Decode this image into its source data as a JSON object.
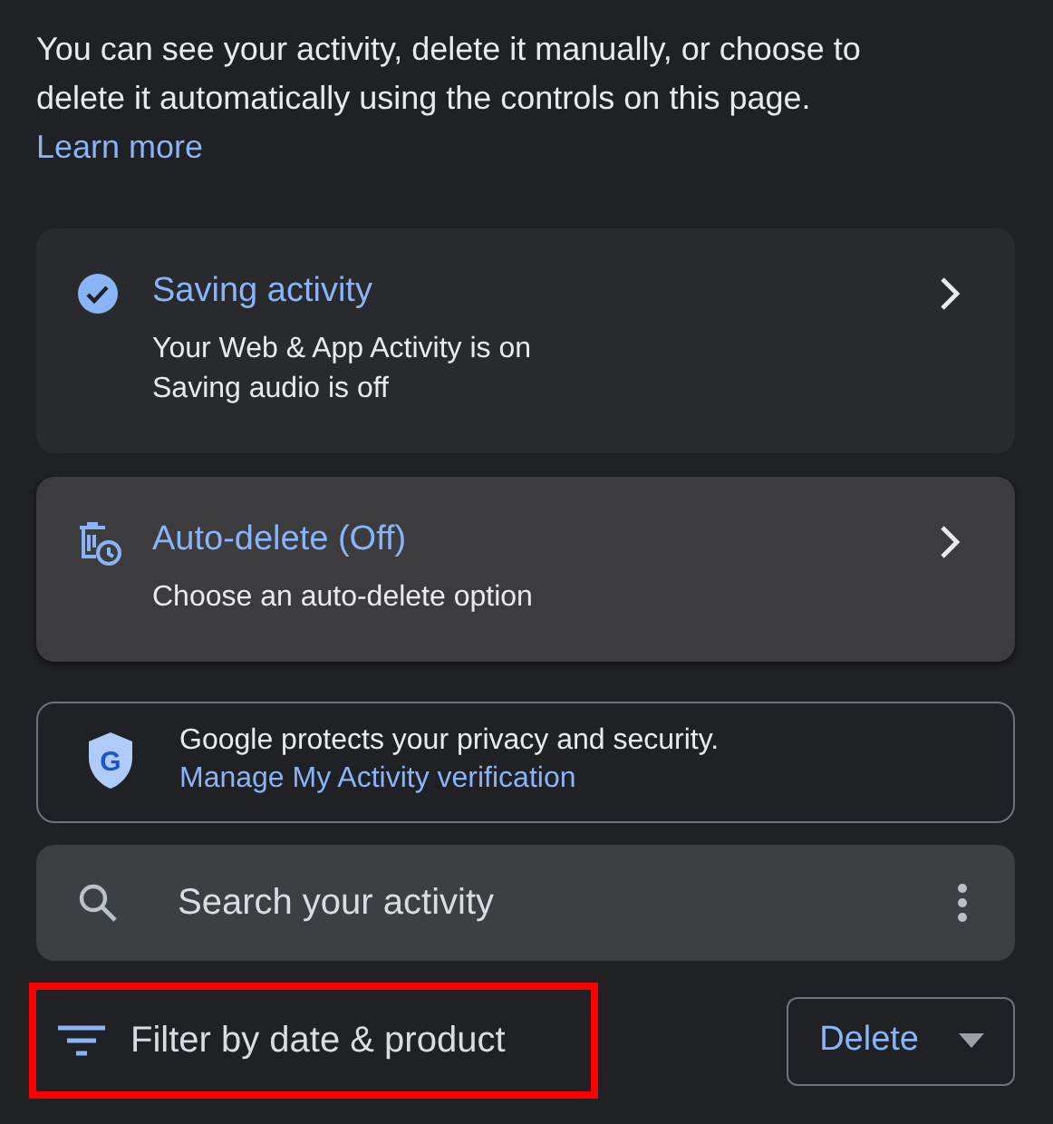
{
  "intro": {
    "text": "You can see your activity, delete it manually, or choose to delete it automatically using the controls on this page.",
    "link": "Learn more"
  },
  "cards": [
    {
      "kind": "saving",
      "title": "Saving activity",
      "lines": [
        "Your Web & App Activity is on",
        "Saving audio is off"
      ],
      "hovered": false
    },
    {
      "kind": "autodelete",
      "title": "Auto-delete (Off)",
      "lines": [
        "Choose an auto-delete option"
      ],
      "hovered": true
    }
  ],
  "privacy": {
    "badge": "G",
    "text": "Google protects your privacy and security.",
    "link": "Manage My Activity verification"
  },
  "search": {
    "placeholder": "Search your activity"
  },
  "filter": {
    "label": "Filter by date & product",
    "highlighted": true
  },
  "delete_button": {
    "label": "Delete"
  }
}
